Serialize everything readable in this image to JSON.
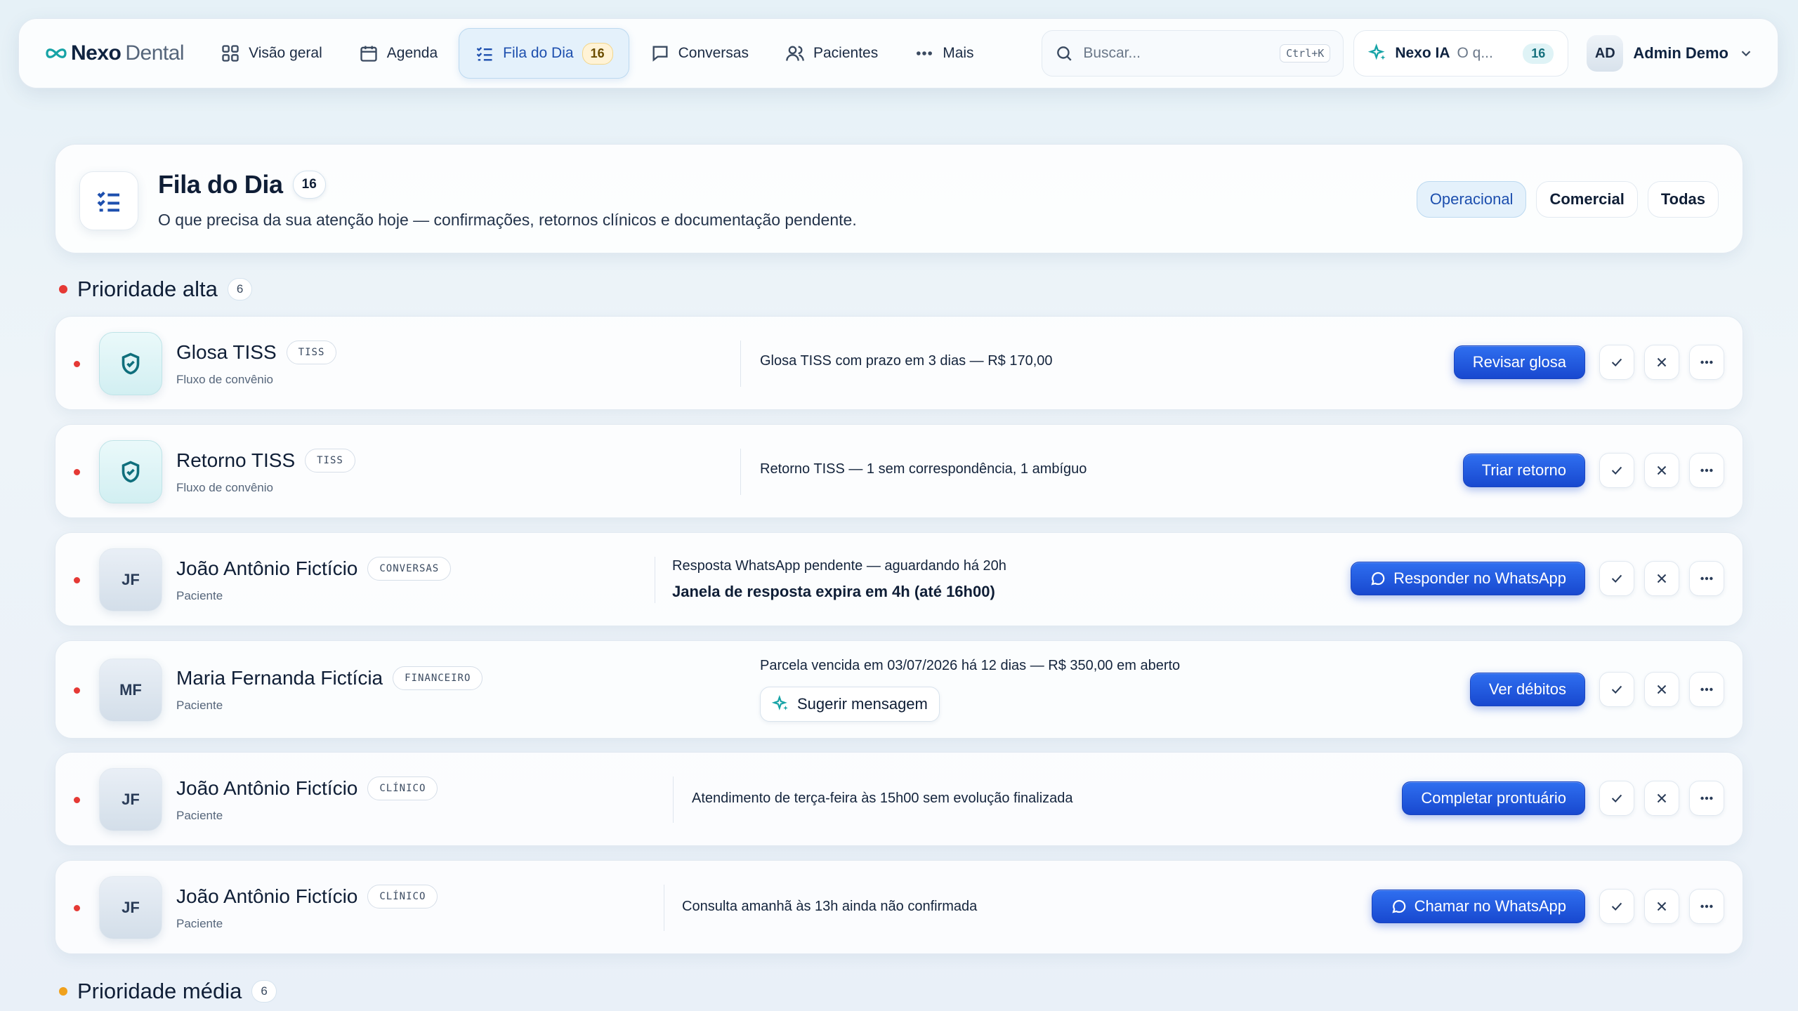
{
  "brand": {
    "name_bold": "Nexo",
    "name_light": "Dental"
  },
  "nav": {
    "items": [
      {
        "label": "Visão geral",
        "icon": "grid-icon"
      },
      {
        "label": "Agenda",
        "icon": "calendar-icon"
      },
      {
        "label": "Fila do Dia",
        "icon": "checklist-icon",
        "badge": "16",
        "active": true
      },
      {
        "label": "Conversas",
        "icon": "chat-icon"
      },
      {
        "label": "Pacientes",
        "icon": "users-icon"
      },
      {
        "label": "Mais",
        "icon": "more-icon"
      }
    ]
  },
  "search": {
    "placeholder": "Buscar...",
    "shortcut": "Ctrl+K"
  },
  "ia": {
    "name": "Nexo IA",
    "prompt": "O q...",
    "count": "16"
  },
  "user": {
    "initials": "AD",
    "name": "Admin Demo"
  },
  "header": {
    "title": "Fila do Dia",
    "count": "16",
    "subtitle": "O que precisa da sua atenção hoje — confirmações, retornos clínicos e documentação pendente.",
    "filters": [
      "Operacional",
      "Comercial",
      "Todas"
    ],
    "active_filter": "Operacional"
  },
  "sections": {
    "high": {
      "title": "Prioridade alta",
      "count": "6"
    },
    "medium": {
      "title": "Prioridade média",
      "count": "6"
    }
  },
  "rows": [
    {
      "avatar": "",
      "avatar_icon": "shield-check-icon",
      "name": "Glosa TISS",
      "tag": "TISS",
      "kind": "Fluxo de convênio",
      "desc": "Glosa TISS com prazo em 3 dias — R$ 170,00",
      "action": "Revisar glosa"
    },
    {
      "avatar": "",
      "avatar_icon": "shield-check-icon",
      "name": "Retorno TISS",
      "tag": "TISS",
      "kind": "Fluxo de convênio",
      "desc": "Retorno TISS — 1 sem correspondência, 1 ambíguo",
      "action": "Triar retorno"
    },
    {
      "avatar": "JF",
      "name": "João Antônio Fictício",
      "tag": "CONVERSAS",
      "kind": "Paciente",
      "desc": "Resposta WhatsApp pendente — aguardando há 20h",
      "desc2": "Janela de resposta expira em 4h (até 16h00)",
      "action": "Responder no WhatsApp",
      "action_icon": "whatsapp-icon"
    },
    {
      "avatar": "MF",
      "name": "Maria Fernanda Fictícia",
      "tag": "FINANCEIRO",
      "kind": "Paciente",
      "desc": "Parcela vencida em 03/07/2026 há 12 dias — R$ 350,00 em aberto",
      "suggest": "Sugerir mensagem",
      "action": "Ver débitos"
    },
    {
      "avatar": "JF",
      "name": "João Antônio Fictício",
      "tag": "CLÍNICO",
      "kind": "Paciente",
      "desc": "Atendimento de terça-feira às 15h00 sem evolução finalizada",
      "action": "Completar prontuário"
    },
    {
      "avatar": "JF",
      "name": "João Antônio Fictício",
      "tag": "CLÍNICO",
      "kind": "Paciente",
      "desc": "Consulta amanhã às 13h ainda não confirmada",
      "action": "Chamar no WhatsApp",
      "action_icon": "whatsapp-icon"
    }
  ],
  "colors": {
    "accent": "#1d4fae",
    "primary_button": "#1848cf",
    "high_priority": "#e53935",
    "medium_priority": "#f0a11c"
  }
}
